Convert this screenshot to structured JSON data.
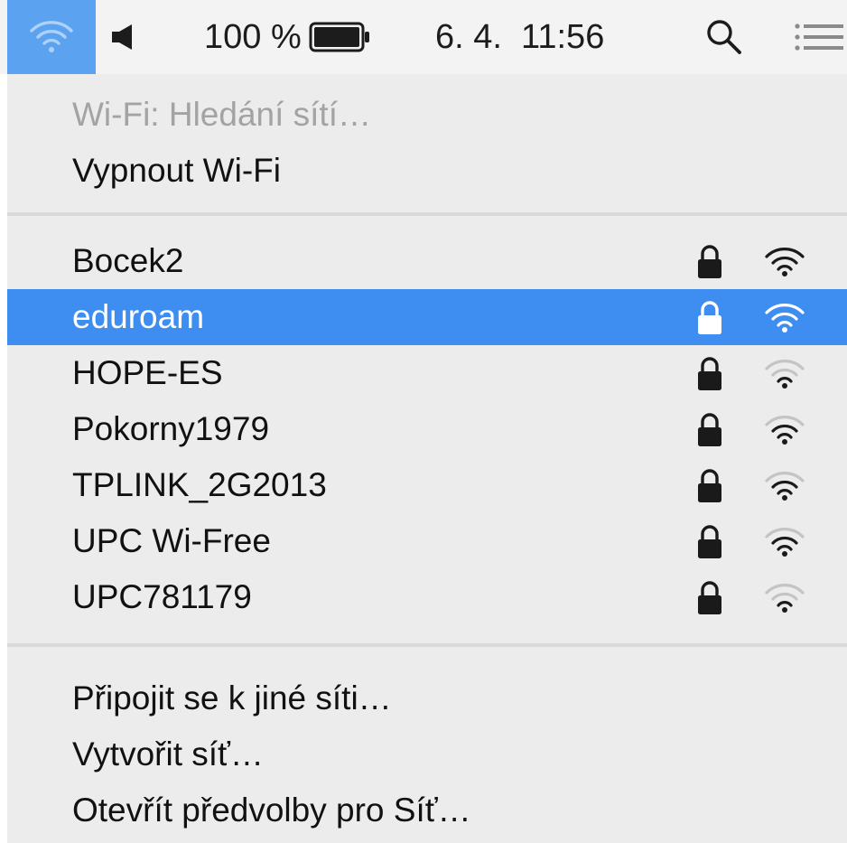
{
  "menubar": {
    "wifi_icon": "wifi-icon",
    "volume_icon": "speaker-icon",
    "battery_percent": "100 %",
    "battery_icon": "battery-icon",
    "datetime": "6. 4.  11:56",
    "search_icon": "magnifier-icon",
    "notifications_icon": "list-icon",
    "active_color": "#5ba3f0"
  },
  "menu": {
    "status": "Wi-Fi: Hledání sítí…",
    "toggle": "Vypnout Wi-Fi",
    "networks": [
      {
        "name": "Bocek2",
        "locked": true,
        "signal": 3
      },
      {
        "name": "eduroam",
        "locked": true,
        "signal": 3,
        "selected": true
      },
      {
        "name": "HOPE-ES",
        "locked": true,
        "signal": 1
      },
      {
        "name": "Pokorny1979",
        "locked": true,
        "signal": 2
      },
      {
        "name": "TPLINK_2G2013",
        "locked": true,
        "signal": 2
      },
      {
        "name": "UPC Wi-Free",
        "locked": true,
        "signal": 2
      },
      {
        "name": "UPC781179",
        "locked": true,
        "signal": 1
      }
    ],
    "actions": {
      "join_other": "Připojit se k jiné síti…",
      "create": "Vytvořit síť…",
      "preferences": "Otevřít předvolby pro Síť…"
    },
    "highlight_color": "#3d8ef0"
  }
}
